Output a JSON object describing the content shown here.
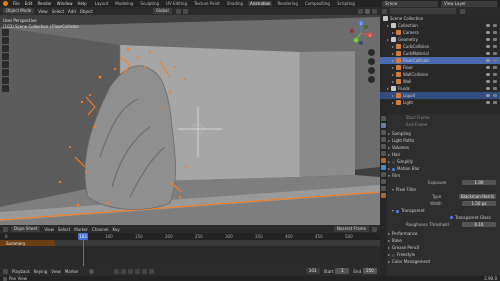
{
  "colors": {
    "accent": "#4a6fd6",
    "selection_orange": "#ff7b1c",
    "viewport_bg": "#3f3f3f",
    "selected_row": "#334d80",
    "active_row": "#4a6bb0",
    "checked_box": "#4c77d8"
  },
  "topbar": {
    "menus": [
      "File",
      "Edit",
      "Render",
      "Window",
      "Help"
    ],
    "workspaces": [
      "Layout",
      "Modeling",
      "Sculpting",
      "UV Editing",
      "Texture Paint",
      "Shading",
      "Animation",
      "Rendering",
      "Compositing",
      "Scripting"
    ],
    "active_workspace": "Animation",
    "scene": "Scene",
    "view_layer": "View Layer"
  },
  "viewport": {
    "mode": "Object Mode",
    "menus": [
      "View",
      "Select",
      "Add",
      "Object"
    ],
    "orientation": "Global",
    "info_line1": "User Perspective",
    "info_line2": "(103) Scene Collection | FloorCollision",
    "gizmo": {
      "x": "X",
      "y": "Y",
      "z": "Z"
    }
  },
  "timeline": {
    "editor": "Dope Sheet",
    "menus": [
      "View",
      "Select",
      "Marker",
      "Channel",
      "Key"
    ],
    "keying": "Nearest Frame",
    "summary_label": "Summary",
    "ruler": [
      "0",
      "100",
      "150",
      "200",
      "250",
      "300",
      "350",
      "400",
      "450",
      "500"
    ],
    "current_frame": "103",
    "footer": {
      "playback": "Playback",
      "keying": "Keying",
      "view": "View",
      "marker": "Marker",
      "frame": "103",
      "start_label": "Start",
      "start": "1",
      "end_label": "End",
      "end": "250"
    }
  },
  "statusbar": {
    "left": "Pan View",
    "right": "2.90.0"
  },
  "outliner": {
    "root": "Scene Collection",
    "items": [
      {
        "label": "Collection",
        "depth": 1,
        "icon": "#c8c8c8",
        "state": ""
      },
      {
        "label": "Camera",
        "depth": 2,
        "icon": "#d57a3b",
        "state": ""
      },
      {
        "label": "Geometry",
        "depth": 1,
        "icon": "#c8c8c8",
        "state": ""
      },
      {
        "label": "CurbCollision",
        "depth": 2,
        "icon": "#d57a3b",
        "state": ""
      },
      {
        "label": "CurbMaterial",
        "depth": 2,
        "icon": "#d57a3b",
        "state": ""
      },
      {
        "label": "FloorCollision",
        "depth": 2,
        "icon": "#d57a3b",
        "state": "act"
      },
      {
        "label": "Floor",
        "depth": 2,
        "icon": "#d57a3b",
        "state": ""
      },
      {
        "label": "WallCollision",
        "depth": 2,
        "icon": "#d57a3b",
        "state": ""
      },
      {
        "label": "Wall",
        "depth": 2,
        "icon": "#d57a3b",
        "state": ""
      },
      {
        "label": "Fluids",
        "depth": 1,
        "icon": "#c8c8c8",
        "state": ""
      },
      {
        "label": "Liquid",
        "depth": 2,
        "icon": "#d57a3b",
        "state": "sel"
      },
      {
        "label": "Light",
        "depth": 2,
        "icon": "#d57a3b",
        "state": ""
      }
    ]
  },
  "properties": {
    "start_frame_label": "Start Frame",
    "end_frame_label": "End Frame",
    "sections": {
      "sampling": "Sampling",
      "light_paths": "Light Paths",
      "volumes": "Volumes",
      "hair": "Hair",
      "simplify": "Simplify",
      "motion_blur": "Motion Blur",
      "film": "Film",
      "pixel_filter": "Pixel Filter",
      "transparent": "Transparent",
      "transparent_glass": "Transparent Glass",
      "performance": "Performance",
      "bake": "Bake",
      "grease_pencil": "Grease Pencil",
      "freestyle": "Freestyle",
      "color_management": "Color Management"
    },
    "exposure_label": "Exposure",
    "exposure": "1.00",
    "type_label": "Type",
    "type": "Blackman-Harris",
    "width_label": "Width",
    "width": "1.50 px",
    "roughness_label": "Roughness Threshold",
    "roughness": "0.10"
  }
}
